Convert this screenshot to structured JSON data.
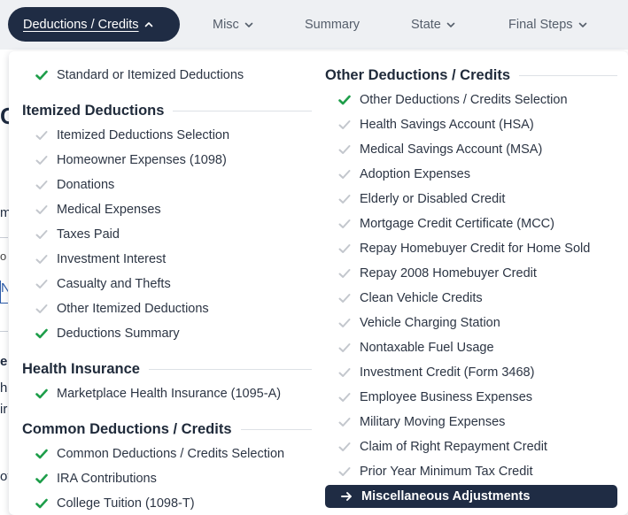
{
  "nav": {
    "items": [
      {
        "label": "Deductions / Credits",
        "active": true
      },
      {
        "label": "Misc"
      },
      {
        "label": "Summary"
      },
      {
        "label": "State"
      },
      {
        "label": "Final Steps"
      }
    ]
  },
  "background_page": {
    "fragments": [
      "C",
      "m",
      "o",
      "N",
      "e",
      "ho",
      "ir",
      "ot"
    ]
  },
  "menu": {
    "left": {
      "top_items": [
        {
          "label": "Standard or Itemized Deductions",
          "status": "done"
        }
      ],
      "sections": [
        {
          "heading": "Itemized Deductions",
          "items": [
            {
              "label": "Itemized Deductions Selection",
              "status": "pending"
            },
            {
              "label": "Homeowner Expenses (1098)",
              "status": "pending"
            },
            {
              "label": "Donations",
              "status": "pending"
            },
            {
              "label": "Medical Expenses",
              "status": "pending"
            },
            {
              "label": "Taxes Paid",
              "status": "pending"
            },
            {
              "label": "Investment Interest",
              "status": "pending"
            },
            {
              "label": "Casualty and Thefts",
              "status": "pending"
            },
            {
              "label": "Other Itemized Deductions",
              "status": "pending"
            },
            {
              "label": "Deductions Summary",
              "status": "done"
            }
          ]
        },
        {
          "heading": "Health Insurance",
          "items": [
            {
              "label": "Marketplace Health Insurance (1095-A)",
              "status": "done"
            }
          ]
        },
        {
          "heading": "Common Deductions / Credits",
          "items": [
            {
              "label": "Common Deductions / Credits Selection",
              "status": "done"
            },
            {
              "label": "IRA Contributions",
              "status": "done"
            },
            {
              "label": "College Tuition (1098-T)",
              "status": "done"
            }
          ]
        }
      ]
    },
    "right": {
      "sections": [
        {
          "heading": "Other Deductions / Credits",
          "items": [
            {
              "label": "Other Deductions / Credits Selection",
              "status": "done"
            },
            {
              "label": "Health Savings Account (HSA)",
              "status": "pending"
            },
            {
              "label": "Medical Savings Account (MSA)",
              "status": "pending"
            },
            {
              "label": "Adoption Expenses",
              "status": "pending"
            },
            {
              "label": "Elderly or Disabled Credit",
              "status": "pending"
            },
            {
              "label": "Mortgage Credit Certificate (MCC)",
              "status": "pending"
            },
            {
              "label": "Repay Homebuyer Credit for Home Sold",
              "status": "pending"
            },
            {
              "label": "Repay 2008 Homebuyer Credit",
              "status": "pending"
            },
            {
              "label": "Clean Vehicle Credits",
              "status": "pending"
            },
            {
              "label": "Vehicle Charging Station",
              "status": "pending"
            },
            {
              "label": "Nontaxable Fuel Usage",
              "status": "pending"
            },
            {
              "label": "Investment Credit (Form 3468)",
              "status": "pending"
            },
            {
              "label": "Employee Business Expenses",
              "status": "pending"
            },
            {
              "label": "Military Moving Expenses",
              "status": "pending"
            },
            {
              "label": "Claim of Right Repayment Credit",
              "status": "pending"
            },
            {
              "label": "Prior Year Minimum Tax Credit",
              "status": "pending"
            },
            {
              "label": "Miscellaneous Adjustments",
              "status": "current"
            }
          ]
        }
      ]
    }
  },
  "colors": {
    "nav_active_bg": "#1f2c44",
    "check_done": "#1e9e4a",
    "check_pending": "#c3c7cd",
    "current_bg": "#1f2c44"
  }
}
